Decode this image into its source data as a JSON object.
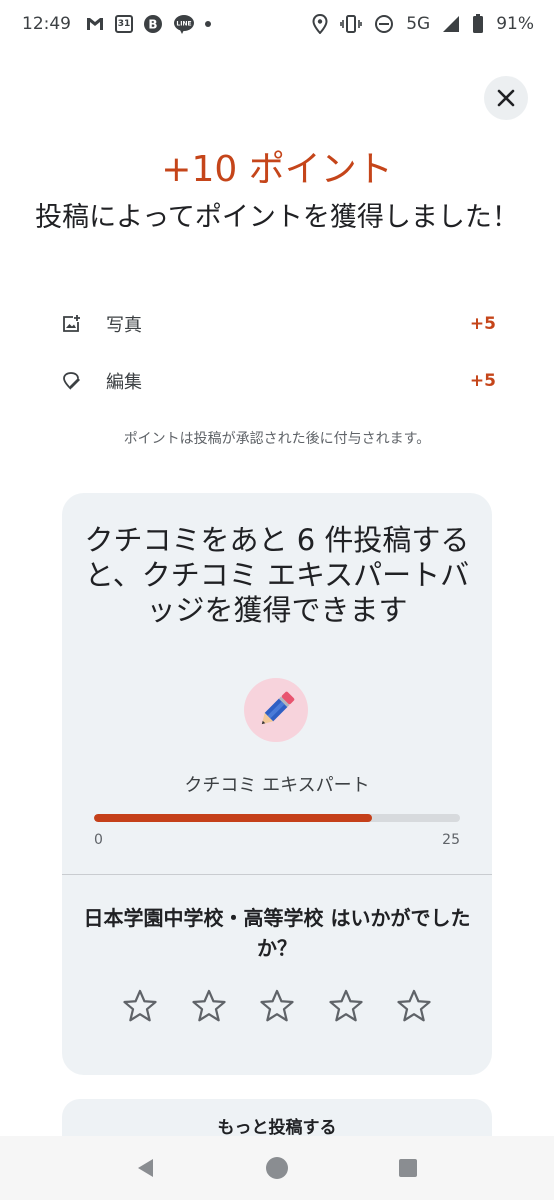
{
  "status_bar": {
    "time": "12:49",
    "calendar_day": "31",
    "network": "5G",
    "battery": "91%"
  },
  "dialog": {
    "points_title": "+10 ポイント",
    "earned_message": "投稿によってポイントを獲得しました！",
    "breakdown": [
      {
        "icon": "photo-add-icon",
        "label": "写真",
        "value": "+5"
      },
      {
        "icon": "edit-icon",
        "label": "編集",
        "value": "+5"
      }
    ],
    "note": "ポイントは投稿が承認された後に付与されます。"
  },
  "badge_card": {
    "headline": "クチコミをあと 6 件投稿すると、クチコミ エキスパートバッジを獲得できます",
    "badge_icon": "pencil-icon",
    "badge_name": "クチコミ エキスパート",
    "progress_value": 19,
    "progress_min": "0",
    "progress_max": "25",
    "rating_question": "日本学園中学校・高等学校 はいかがでしたか？",
    "stars": 5
  },
  "more_button": {
    "label": "もっと投稿する"
  },
  "colors": {
    "accent": "#c5451a",
    "card_bg": "#eef2f5"
  }
}
